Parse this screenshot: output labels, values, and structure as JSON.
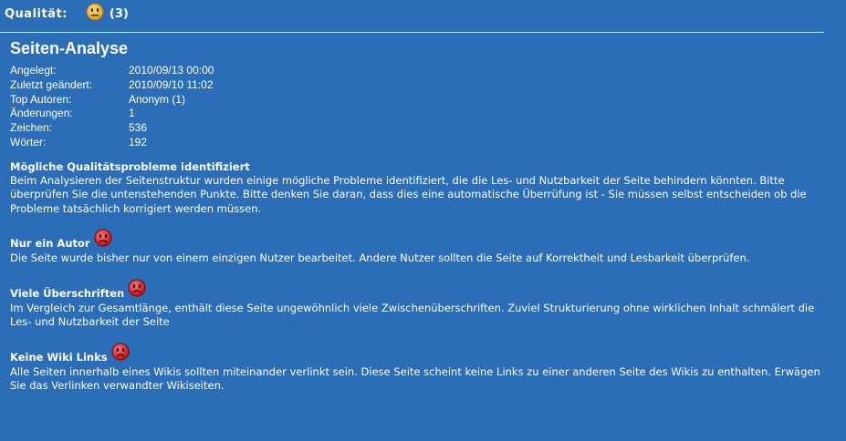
{
  "quality": {
    "label": "Qualität:",
    "icon": "neutral-face-icon",
    "count": "(3)"
  },
  "analysis": {
    "title": "Seiten-Analyse",
    "meta": [
      {
        "key": "Angelegt:",
        "value": "2010/09/13 00:00"
      },
      {
        "key": "Zuletzt geändert:",
        "value": "2010/09/10 11:02"
      },
      {
        "key": "Top Autoren:",
        "value": "Anonym (1)"
      },
      {
        "key": "Änderungen:",
        "value": "1"
      },
      {
        "key": "Zeichen:",
        "value": "536"
      },
      {
        "key": "Wörter:",
        "value": "192"
      }
    ],
    "problems_heading": "Mögliche Qualitätsprobleme identifiziert",
    "problems_intro": "Beim Analysieren der Seitenstruktur wurden einige mögliche Probleme identifiziert, die die Les- und Nutzbarkeit der Seite behindern könnten. Bitte überprüfen Sie die untenstehenden Punkte. Bitte denken Sie daran, dass dies eine automatische Überrüfung ist - Sie müssen selbst entscheiden ob die Probleme tatsächlich korrigiert werden müssen.",
    "issues": [
      {
        "title": "Nur ein Autor",
        "icon": "sad-face-icon",
        "text": "Die Seite wurde bisher nur von einem einzigen Nutzer bearbeitet. Andere Nutzer sollten die Seite auf Korrektheit und Lesbarkeit überprüfen."
      },
      {
        "title": "Viele Überschriften",
        "icon": "sad-face-icon",
        "text": "Im Vergleich zur Gesamtlänge, enthält diese Seite ungewöhnlich viele Zwischenüberschriften. Zuviel Strukturierung ohne wirklichen Inhalt schmälert die Les- und Nutzbarkeit der Seite"
      },
      {
        "title": "Keine Wiki Links",
        "icon": "sad-face-icon",
        "text": "Alle Seiten innerhalb eines Wikis sollten miteinander verlinkt sein. Diese Seite scheint keine Links zu einer anderen Seite des Wikis zu enthalten. Erwägen Sie das Verlinken verwandter Wikiseiten."
      }
    ]
  },
  "colors": {
    "background": "#2b6db6",
    "text": "#ffffff",
    "neutral_face": "#f2b62e",
    "sad_face": "#d81e1e"
  }
}
